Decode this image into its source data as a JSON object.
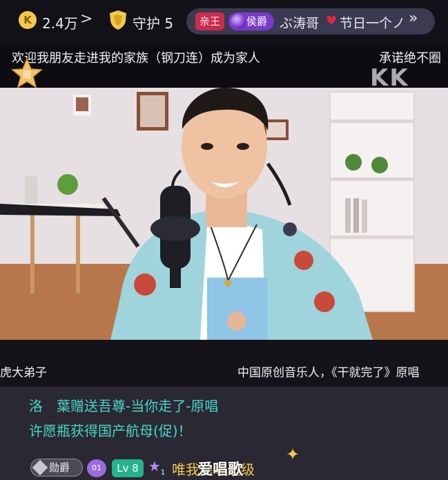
{
  "topbar": {
    "coins": "2.4万",
    "coin_chevron": ">",
    "coin_icon": "coin-icon",
    "guard_label": "守护 5",
    "pill": {
      "badge_red": "亲王",
      "badge_purple": "侯爵",
      "name": "ぶ涛哥",
      "tail": "节日一个ノ",
      "chevron": "»"
    }
  },
  "announcement": {
    "left": "欢迎我朋友走进我的家族（钢刀连）成为家人",
    "right": "承诺绝不圈",
    "star_label": "周",
    "watermark": "KK"
  },
  "captions": {
    "left": "虎大弟子",
    "right": "中国原创音乐人，《干就完了》原唱"
  },
  "chat": {
    "line1": "洛　葉赠送吾尊-当你走了-原唱",
    "line2": "许愿瓶获得国产航母(促)！",
    "rank_badge": "勋爵",
    "fan_badge": "01",
    "level_badge": "Lv 8",
    "vip_sub": "1",
    "line3": "唯我独尊超级"
  },
  "overlay": {
    "brand": "爱唱歌"
  },
  "colors": {
    "chat_text": "#49d6c6",
    "gold": "#f2c94c",
    "badge_red": "#c92d4b",
    "badge_purple": "#7a3cc7",
    "level_green": "#25b38c"
  }
}
